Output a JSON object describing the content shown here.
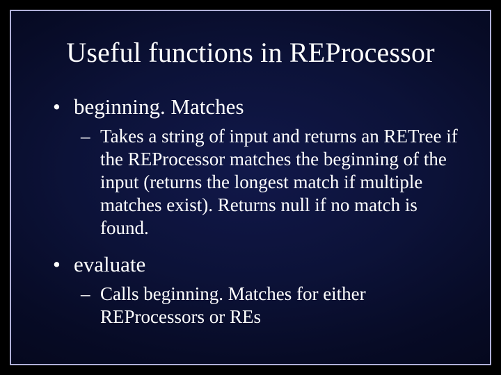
{
  "slide": {
    "title": "Useful functions in REProcessor",
    "bullets": [
      {
        "label": "beginning. Matches",
        "sub": [
          "Takes a string of input and returns an RETree if the REProcessor matches the beginning of the input (returns the longest match if multiple matches exist).  Returns null if no match is found."
        ]
      },
      {
        "label": "evaluate",
        "sub": [
          "Calls beginning. Matches for either REProcessors or REs"
        ]
      }
    ]
  }
}
